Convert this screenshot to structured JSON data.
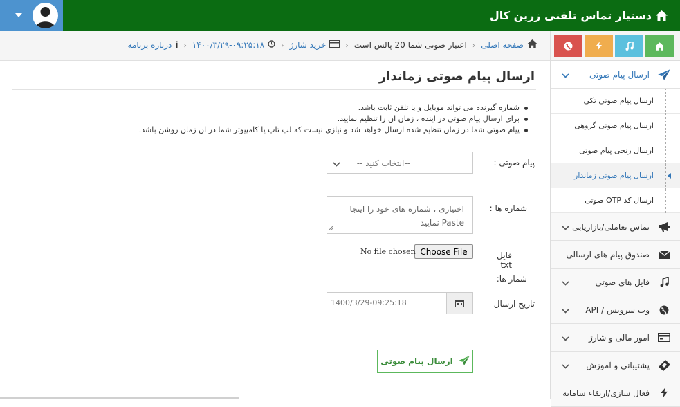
{
  "header": {
    "brand": "دستیار تماس تلفنی زرین کال"
  },
  "breadcrumb": {
    "home": "صفحه اصلی",
    "credit": "اعتبار صوتی شما 20 پالس است",
    "buy": "خرید شارژ",
    "datetime": "۱۴۰۰/۳/۲۹-۰۹:۲۵:۱۸",
    "about": "درباره برنامه"
  },
  "sidebar": {
    "shortcut_colors": [
      "#5cb85c",
      "#5bc0de",
      "#f0ad4e",
      "#d9534f"
    ],
    "items": [
      {
        "label": "ارسال پیام صوتی"
      },
      {
        "label": "تماس تعاملی/بازاریابی"
      },
      {
        "label": "صندوق پیام های ارسالی"
      },
      {
        "label": "فایل های صوتی"
      },
      {
        "label": "وب سرویس / API"
      },
      {
        "label": "امور مالی و شارژ"
      },
      {
        "label": "پشتیبانی و آموزش"
      },
      {
        "label": "فعال سازی/ارتقاء سامانه"
      }
    ],
    "subitems": [
      {
        "label": "ارسال پیام صوتی تکی"
      },
      {
        "label": "ارسال پیام صوتی گروهی"
      },
      {
        "label": "ارسال رنجی پیام صوتی"
      },
      {
        "label": "ارسال پیام صوتی زماندار"
      },
      {
        "label": "ارسال کد OTP صوتی"
      }
    ]
  },
  "main": {
    "title": "ارسال پیام صوتی زماندار",
    "rules": [
      "شماره گیرنده می تواند موبایل و یا تلفن ثابت باشد.",
      "برای ارسال پیام صوتی در اینده ، زمان ان را تنظیم نمایید.",
      "پیام صوتی شما در زمان تنظیم شده ارسال خواهد شد و نیازی نیست که لپ تاپ یا کامپیوتر شما در ان زمان روشن باشد."
    ],
    "voice_label": "پیام صوتی :",
    "voice_select": "--انتخاب کنید --",
    "numbers_label": "شماره ها :",
    "numbers_placeholder": "اختیاری ، شماره های خود را اینجا Paste نمایید",
    "file_label_1": "فایل txt",
    "file_label_2": "شمار ها:",
    "file_button": "Choose File",
    "file_status": "No file chosen",
    "date_label": "تاریخ ارسال",
    "date_value": "1400/3/29-09:25:18",
    "submit": "ارسال پیام صوتی"
  }
}
